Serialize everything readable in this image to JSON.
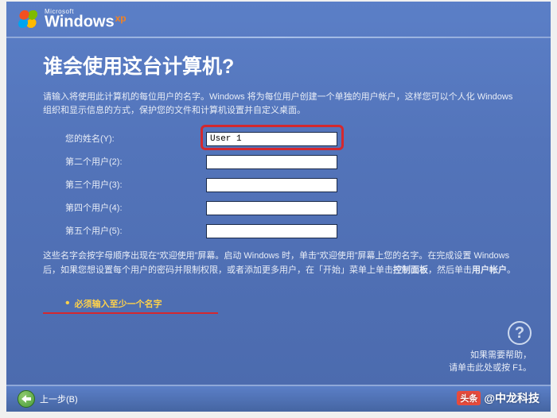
{
  "brand": {
    "company": "Microsoft",
    "product": "Windows",
    "edition": "xp"
  },
  "title": "谁会使用这台计算机?",
  "intro": "请输入将使用此计算机的每位用户的名字。Windows 将为每位用户创建一个单独的用户帐户，这样您可以个人化 Windows 组织和显示信息的方式，保护您的文件和计算机设置并自定义桌面。",
  "fields": [
    {
      "label": "您的姓名",
      "hotkey": "(Y)",
      "value": "User 1",
      "highlighted": true
    },
    {
      "label": "第二个用户",
      "hotkey": "(2)",
      "value": ""
    },
    {
      "label": "第三个用户",
      "hotkey": "(3)",
      "value": ""
    },
    {
      "label": "第四个用户",
      "hotkey": "(4)",
      "value": ""
    },
    {
      "label": "第五个用户",
      "hotkey": "(5)",
      "value": ""
    }
  ],
  "note_parts": {
    "p1": "这些名字会按字母顺序出现在“欢迎使用”屏幕。启动 Windows 时，单击“欢迎使用”屏幕上您的名字。在完成设置 Windows 后，如果您想设置每个用户的密码并限制权限，或者添加更多用户，在「开始」菜单上单击",
    "b1": "控制面板",
    "p2": "，然后单击",
    "b2": "用户帐户",
    "p3": "。"
  },
  "warning": "必须输入至少一个名字",
  "help": {
    "line1": "如果需要帮助，",
    "line2": "请单击此处或按 F1。"
  },
  "footer": {
    "back": "上一步",
    "back_hotkey": "(B)"
  },
  "watermark": {
    "prefix": "头条",
    "source": "@中龙科技"
  }
}
